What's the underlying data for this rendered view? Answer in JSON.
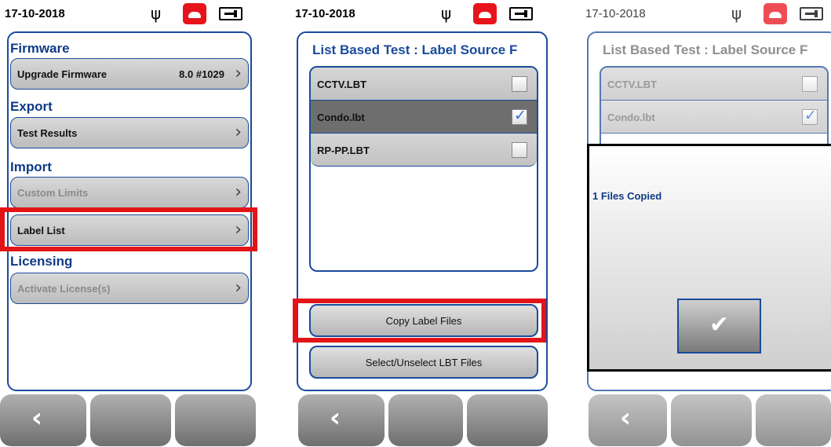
{
  "screens": [
    {
      "date": "17-10-2018",
      "sections": {
        "firmware": "Firmware",
        "export": "Export",
        "import": "Import",
        "licensing": "Licensing"
      },
      "rows": {
        "upgrade_firmware": {
          "label": "Upgrade Firmware",
          "value": "8.0 #1029"
        },
        "test_results": {
          "label": "Test Results"
        },
        "custom_limits": {
          "label": "Custom Limits"
        },
        "label_list": {
          "label": "Label List"
        },
        "activate_license": {
          "label": "Activate License(s)"
        }
      }
    },
    {
      "date": "17-10-2018",
      "title": "List Based Test : Label Source F",
      "files": [
        {
          "name": "CCTV.LBT",
          "checked": false
        },
        {
          "name": "Condo.lbt",
          "checked": true
        },
        {
          "name": "RP-PP.LBT",
          "checked": false
        }
      ],
      "buttons": {
        "copy": "Copy Label Files",
        "select": "Select/Unselect LBT Files"
      }
    },
    {
      "date": "17-10-2018",
      "title": "List Based Test : Label Source F",
      "files": [
        {
          "name": "CCTV.LBT",
          "checked": false
        },
        {
          "name": "Condo.lbt",
          "checked": true
        }
      ],
      "dialog": {
        "message": "1 Files Copied"
      }
    }
  ],
  "icons": {
    "usb": "usb-icon",
    "phone": "phone-hangup-icon",
    "battery": "battery-icon",
    "back": "back-chevron-icon",
    "check": "checkmark-icon"
  },
  "colors": {
    "accent": "#1a4b9b",
    "highlight": "#e31418",
    "phone": "#e8141c"
  }
}
